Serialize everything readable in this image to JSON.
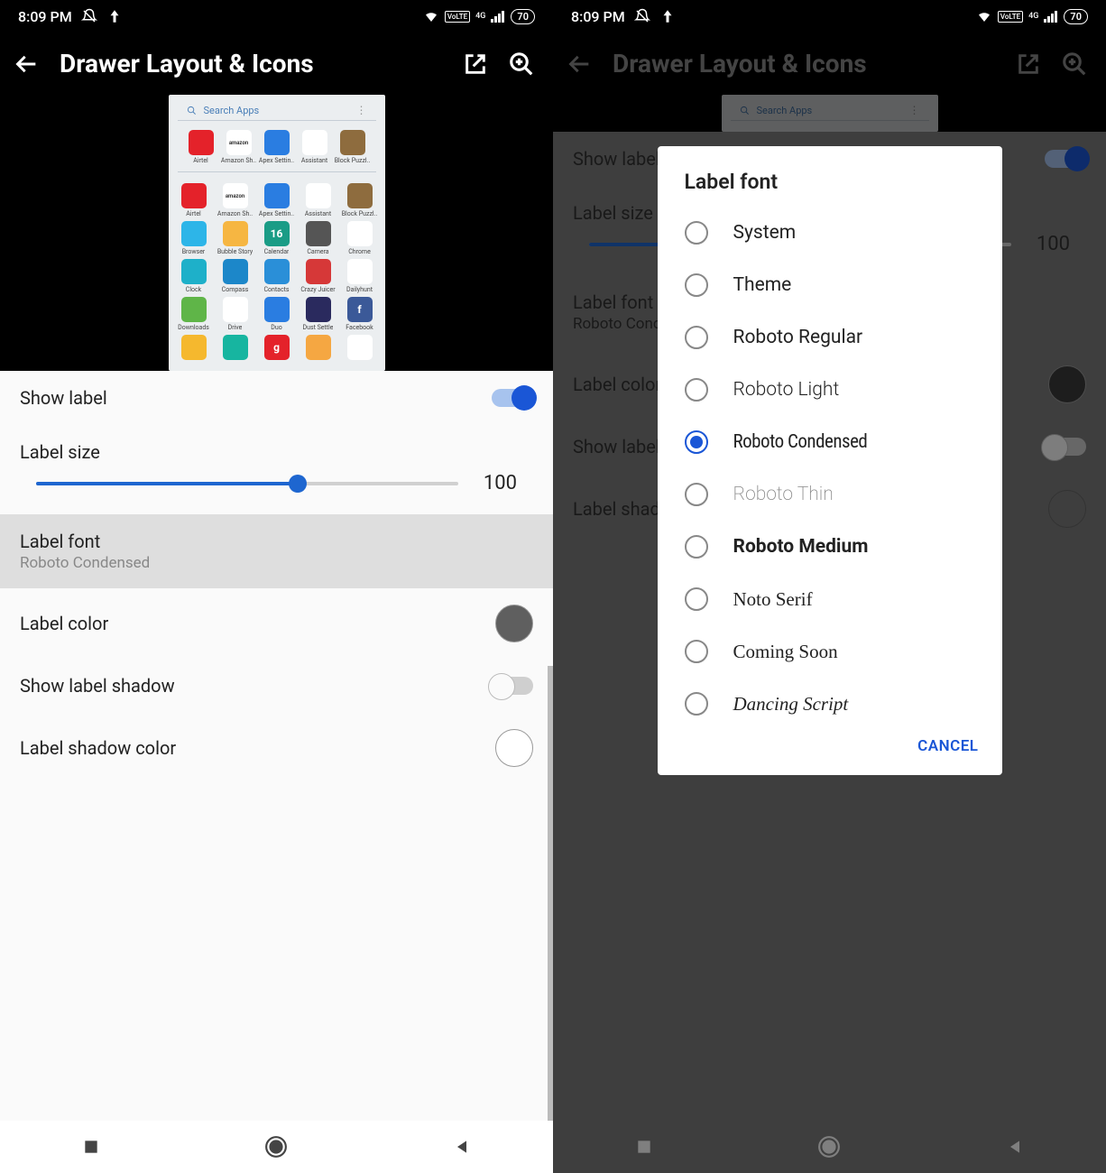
{
  "status": {
    "time": "8:09 PM",
    "battery": "70",
    "net": "4G",
    "lte": "VoLTE"
  },
  "appbar": {
    "title": "Drawer Layout & Icons"
  },
  "search": {
    "placeholder": "Search Apps"
  },
  "apps": {
    "row1": [
      {
        "label": "Airtel",
        "bg": "#e4222a"
      },
      {
        "label": "Amazon Sh..",
        "bg": "#ffffff",
        "txt": "amazon",
        "fg": "#333"
      },
      {
        "label": "Apex Settin..",
        "bg": "#2a7de1"
      },
      {
        "label": "Assistant",
        "bg": "#ffffff"
      },
      {
        "label": "Block Puzzl..",
        "bg": "#8e6c3e"
      }
    ],
    "row2": [
      {
        "label": "Browser",
        "bg": "#2db5e8"
      },
      {
        "label": "Bubble Story",
        "bg": "#f6b642"
      },
      {
        "label": "Calendar",
        "bg": "#1a9c86",
        "txt": "16"
      },
      {
        "label": "Camera",
        "bg": "#555"
      },
      {
        "label": "Chrome",
        "bg": "#fff"
      }
    ],
    "row3": [
      {
        "label": "Clock",
        "bg": "#1eb0c9"
      },
      {
        "label": "Compass",
        "bg": "#1c87c9"
      },
      {
        "label": "Contacts",
        "bg": "#2a8fd8"
      },
      {
        "label": "Crazy Juicer",
        "bg": "#d63838"
      },
      {
        "label": "Dailyhunt",
        "bg": "#fff"
      }
    ],
    "row4": [
      {
        "label": "Downloads",
        "bg": "#5fb548"
      },
      {
        "label": "Drive",
        "bg": "#fff"
      },
      {
        "label": "Duo",
        "bg": "#2a7de1"
      },
      {
        "label": "Dust Settle",
        "bg": "#2a2a5e"
      },
      {
        "label": "Facebook",
        "bg": "#3b5998",
        "txt": "f"
      }
    ],
    "row5": [
      {
        "label": "",
        "bg": "#f5b82e"
      },
      {
        "label": "",
        "bg": "#17b5a0"
      },
      {
        "label": "",
        "bg": "#e4222a",
        "txt": "g"
      },
      {
        "label": "",
        "bg": "#f5a742"
      },
      {
        "label": "",
        "bg": "#fff"
      }
    ]
  },
  "settings": {
    "showLabel": "Show label",
    "labelSize": "Label size",
    "labelSizeVal": "100",
    "labelFont": "Label font",
    "labelFontVal": "Roboto Condensed",
    "labelColor": "Label color",
    "labelColorHex": "#5f5f5f",
    "showShadow": "Show label shadow",
    "shadowColor": "Label shadow color",
    "shadowColorHex": "#ffffff"
  },
  "dialog": {
    "title": "Label font",
    "options": [
      "System",
      "Theme",
      "Roboto Regular",
      "Roboto Light",
      "Roboto Condensed",
      "Roboto Thin",
      "Roboto Medium",
      "Noto Serif",
      "Coming Soon",
      "Dancing Script"
    ],
    "selected": "Roboto Condensed",
    "cancel": "CANCEL"
  }
}
